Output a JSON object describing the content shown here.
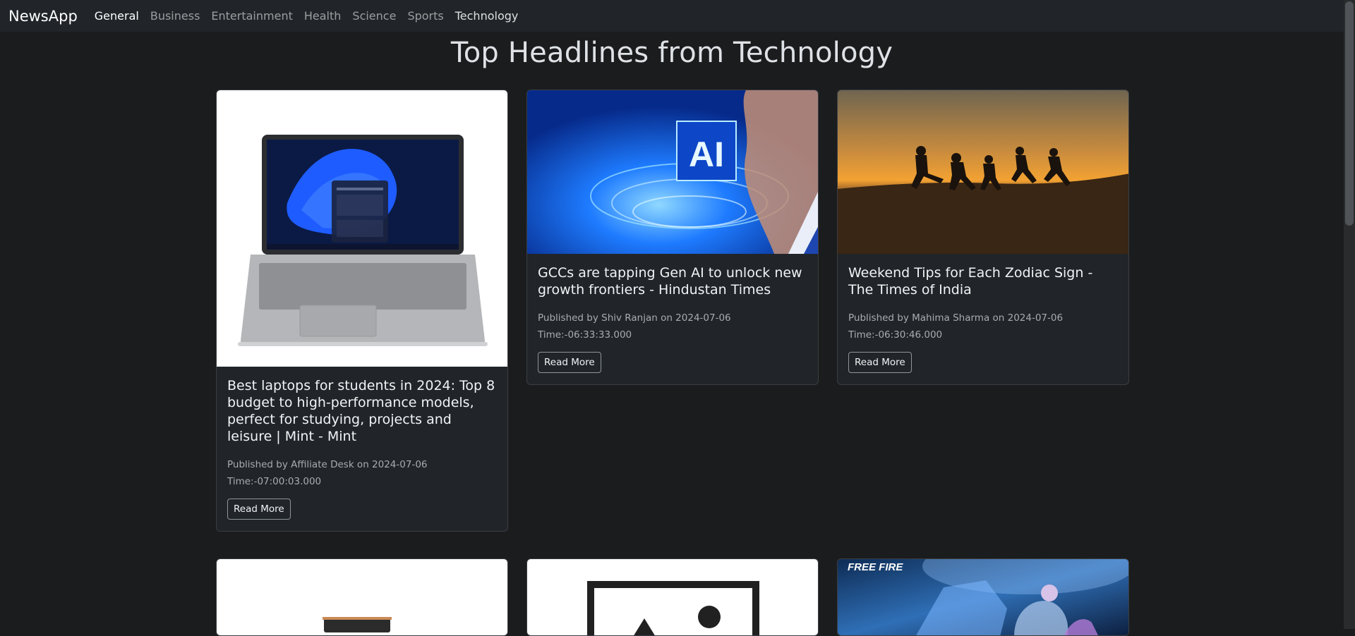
{
  "nav": {
    "brand": "NewsApp",
    "links": [
      "General",
      "Business",
      "Entertainment",
      "Health",
      "Science",
      "Sports",
      "Technology"
    ]
  },
  "heading": "Top Headlines from Technology",
  "cards": [
    {
      "title": "Best laptops for students in 2024: Top 8 budget to high-performance models, perfect for studying, projects and leisure | Mint - Mint",
      "meta_line1": "Published by Affiliate Desk on 2024-07-06",
      "meta_line2": "Time:-07:00:03.000",
      "button": "Read More",
      "image": "laptop-image"
    },
    {
      "title": "GCCs are tapping Gen AI to unlock new growth frontiers - Hindustan Times",
      "meta_line1": "Published by Shiv Ranjan on 2024-07-06 Time:-06:33:33.000",
      "meta_line2": "",
      "button": "Read More",
      "image": "ai-image",
      "image_text": "AI"
    },
    {
      "title": "Weekend Tips for Each Zodiac Sign - The Times of India",
      "meta_line1": "Published by Mahima Sharma on 2024-07-06",
      "meta_line2": "Time:-06:30:46.000",
      "button": "Read More",
      "image": "sunset-silhouettes-image"
    }
  ],
  "second_row": [
    {
      "image": "laptop-partial-image"
    },
    {
      "image": "placeholder-image"
    },
    {
      "image": "free-fire-image",
      "image_text": "FREE FIRE"
    }
  ]
}
